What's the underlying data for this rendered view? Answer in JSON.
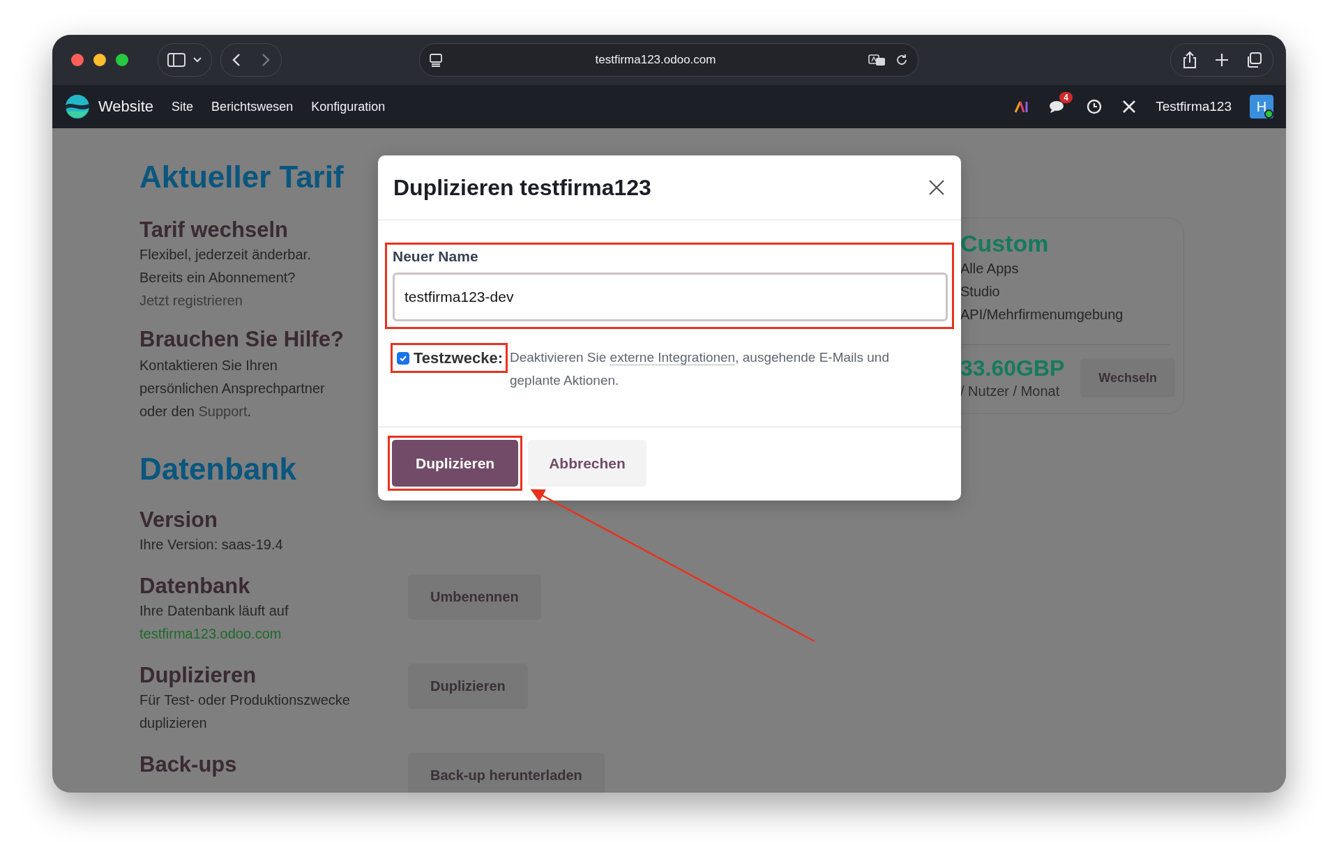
{
  "browser": {
    "address": "testfirma123.odoo.com"
  },
  "navbar": {
    "app": "Website",
    "menu": [
      "Site",
      "Berichtswesen",
      "Konfiguration"
    ],
    "chat_badge": "4",
    "company": "Testfirma123",
    "avatar": "H"
  },
  "plan": {
    "title": "Aktueller Tarif",
    "change": {
      "heading": "Tarif wechseln",
      "lines": [
        "Flexibel, jederzeit änderbar.",
        "Bereits ein Abonnement?"
      ],
      "link": "Jetzt registrieren"
    },
    "help": {
      "heading": "Brauchen Sie Hilfe?",
      "text": "Kontaktieren Sie Ihren persönlichen Ansprechpartner oder den",
      "link": "Support",
      "after": "."
    },
    "card": {
      "name": "Custom",
      "features": [
        "Alle Apps",
        "Studio",
        "API/Mehrfirmenumgebung"
      ],
      "price": "33.60GBP",
      "unit": "/ Nutzer / Monat",
      "button": "Wechseln"
    }
  },
  "database": {
    "title": "Datenbank",
    "rows": [
      {
        "heading": "Version",
        "text": "Ihre Version: saas-19.4"
      },
      {
        "heading": "Datenbank",
        "text": "Ihre Datenbank läuft auf",
        "link": "testfirma123.odoo.com",
        "button": "Umbenennen"
      },
      {
        "heading": "Duplizieren",
        "text": "Für Test- oder Produktionszwecke duplizieren",
        "button": "Duplizieren"
      },
      {
        "heading": "Back-ups",
        "button": "Back-up herunterladen"
      }
    ]
  },
  "dialog": {
    "title": "Duplizieren testfirma123",
    "field_label": "Neuer Name",
    "field_value": "testfirma123-dev",
    "test_checkbox": {
      "label": "Testzwecke:",
      "checked": true
    },
    "description": {
      "before": "Deaktivieren Sie",
      "link": "externe Integrationen",
      "after": ", ausgehende E-Mails und geplante Aktionen."
    },
    "buttons": [
      {
        "label": "Duplizieren",
        "kind": "primary"
      },
      {
        "label": "Abbrechen",
        "kind": "secondary"
      }
    ]
  }
}
